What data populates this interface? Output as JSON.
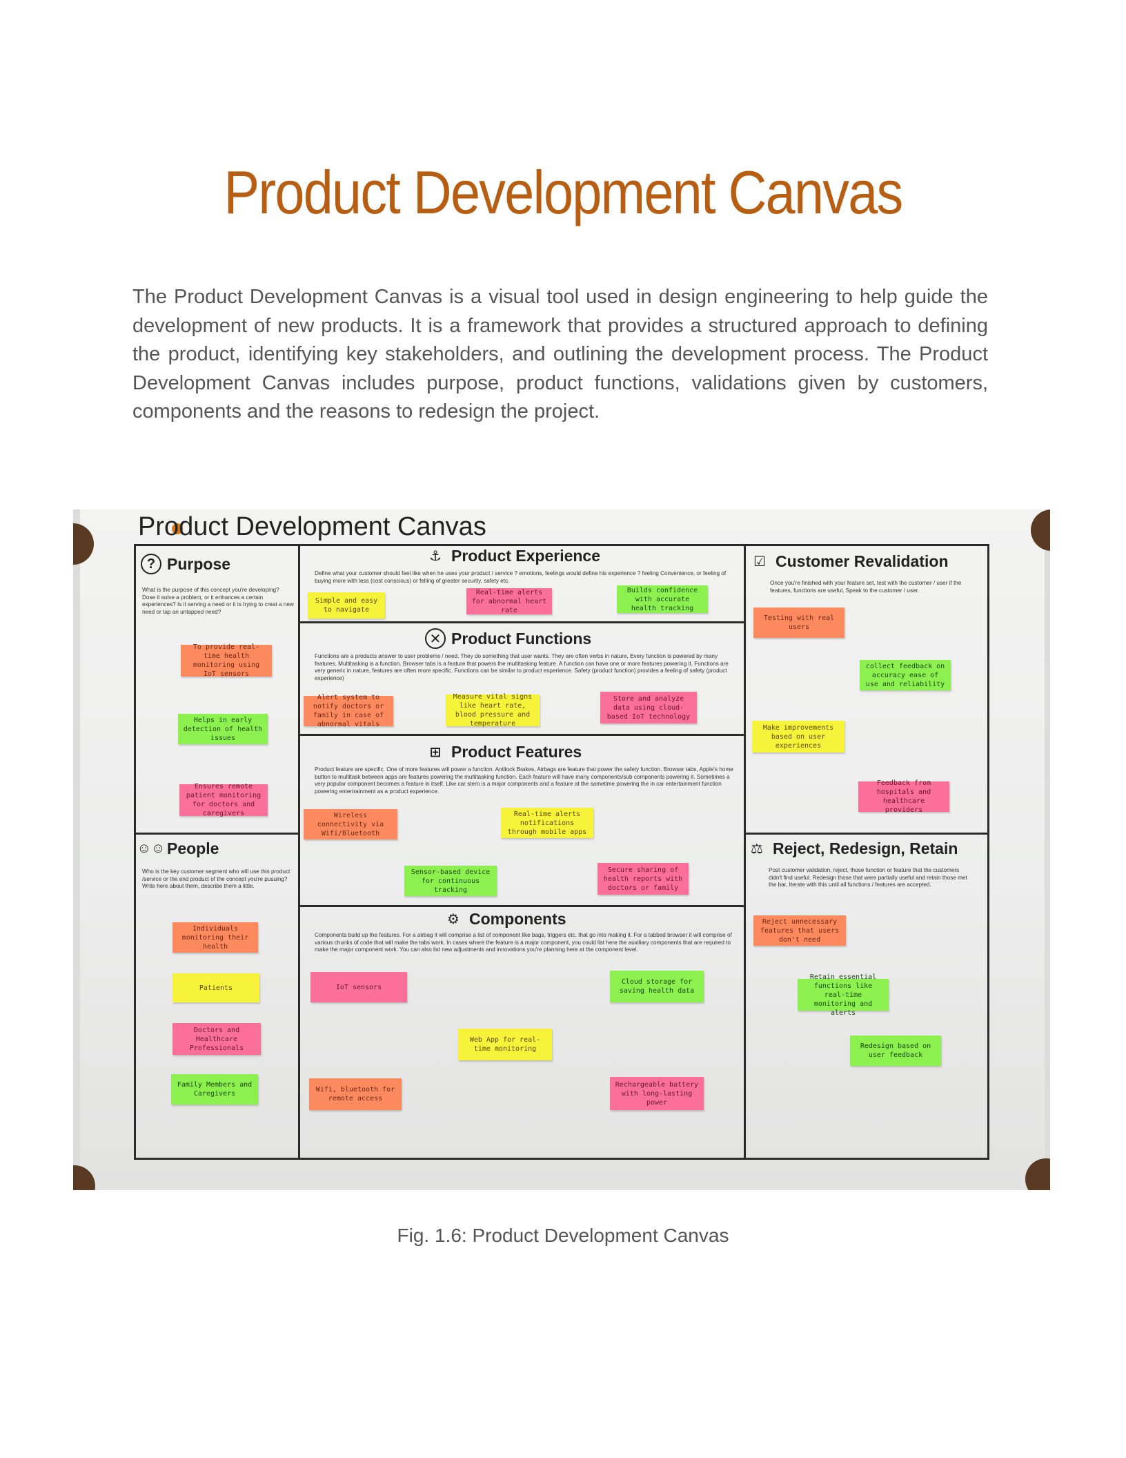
{
  "page": {
    "title": "Product Development Canvas",
    "intro": "The Product Development Canvas is a visual tool used in design engineering to help guide the development of new products. It is a framework that provides a structured approach to defining the product, identifying key stakeholders, and outlining the development process. The Product Development Canvas includes purpose, product functions, validations given by customers, components and the reasons to redesign the project.",
    "caption": "Fig. 1.6: Product Development Canvas"
  },
  "poster": {
    "title": "Product Development Canvas",
    "purpose": {
      "heading": "Purpose",
      "icon": "question-icon",
      "prompt": "What is the purpose of this concept you're developing? Dose it solve a problem, or it enhances a certain experiences? Is it serving a need or it is trying to creat a new need or tap an untapped need?",
      "notes": [
        "To provide real-time health monitoring using IoT sensors",
        "Helps in early detection of health issues",
        "Ensures remote patient monitoring for doctors and caregivers"
      ]
    },
    "people": {
      "heading": "People",
      "icon": "people-icon",
      "prompt": "Who is the key customer segment who will use this product /service or the end product of the concept you're pusuing? Write here about them, describe them a little.",
      "notes": [
        "Individuals monitoring their health",
        "Patients",
        "Doctors and Healthcare Professionals",
        "Family Members and Caregivers"
      ]
    },
    "experience": {
      "heading": "Product Experience",
      "icon": "anchor-icon",
      "prompt": "Define what your customer should feel like when he uses your product / service ? emotions, feelings would define his experience ? feeling Convenience, or feeling of buying more with less (cost conscious) or felling of greater security, safety etc.",
      "notes": [
        "Simple and easy to navigate",
        "Real-time alerts for abnormal heart rate",
        "Builds confidence with accurate health tracking"
      ]
    },
    "functions": {
      "heading": "Product Functions",
      "icon": "tools-icon",
      "prompt": "Functions are a products answer to user problems / need. They do something that user wants. They are often verbs in nature, Every function is powered by many features, Multitasking is a function. Browser tabs is a feature that powers the multitasking feature. A function can have one or more features powering it. Functions are very generic in nature, features are often more specific. Functions can be similar to product experience. Safety (product function) provides a feeling of safety (product experience)",
      "notes": [
        "Alert system to notify doctors or family in case of abnormal vitals",
        "Measure vital signs like heart rate, blood pressure and temperature",
        "Store and analyze data using cloud-based IoT technology"
      ]
    },
    "features": {
      "heading": "Product Features",
      "icon": "medkit-icon",
      "prompt": "Product feature are specific. One of more features will power a function. Antilock Brakes, Airbags are feature that power the safety function. Browser tabs, Apple's home button to multitask between apps are features powering the multitasking function. Each feature will have many components/sub components powering it. Sometimes a very popular component becomes a feature in itself. Like car stero is a major components and a feature at the sametime powering the in car entertainment function powering entertrainment as a product experience.",
      "notes": [
        "Wireless connectivity via Wifi/Bluetooth",
        "Real-time alerts notifications through mobile apps",
        "Sensor-based device for continuous tracking",
        "Secure sharing of health reports with doctors or family"
      ]
    },
    "components": {
      "heading": "Components",
      "icon": "gears-icon",
      "prompt": "Components build up the features. For a airbag it will comprise a list of component like bags, triggers etc. that go into making it. For a tabbed browser it will comprise of various chunks of code that will make the tabs work. In cases where the feature is a major component, you could list here the auxiliary components that are required to make the major component work. You can also list new adjustments and innovations you're planning here at the component level.",
      "notes": [
        "IoT sensors",
        "Cloud storage for saving health data",
        "Web App for real-time monitoring",
        "Wifi, bluetooth for remote access",
        "Rechargeable battery with long-lasting power"
      ]
    },
    "revalidation": {
      "heading": "Customer Revalidation",
      "icon": "checkbox-icon",
      "prompt": "Once you're finished with your feature set, test with the customer / user if the features, functions are useful, Speak to the customer / user.",
      "notes": [
        "Testing with real users",
        "collect feedback on accuracy ease of use and reliability",
        "Make improvements based on user experiences",
        "Feedback from hospitals and healthcare providers"
      ]
    },
    "reject": {
      "heading": "Reject, Redesign, Retain",
      "icon": "flask-icon",
      "prompt": "Post customer validation, reject, those function or feature that the customers didn't find useful. Redesign those that were partially useful and retain those met the bar, Iterate with this until all functions / features are accepted.",
      "notes": [
        "Reject unnecessary features that users don't need",
        "Retain essential functions like real-time monitoring and alerts",
        "Redesign based on user feedback"
      ]
    }
  },
  "colors": {
    "title": "#b85e12",
    "note_orange": "#fd8a5e",
    "note_green": "#8cf04f",
    "note_yellow": "#f7f33a",
    "note_pink": "#fb6f9b"
  }
}
